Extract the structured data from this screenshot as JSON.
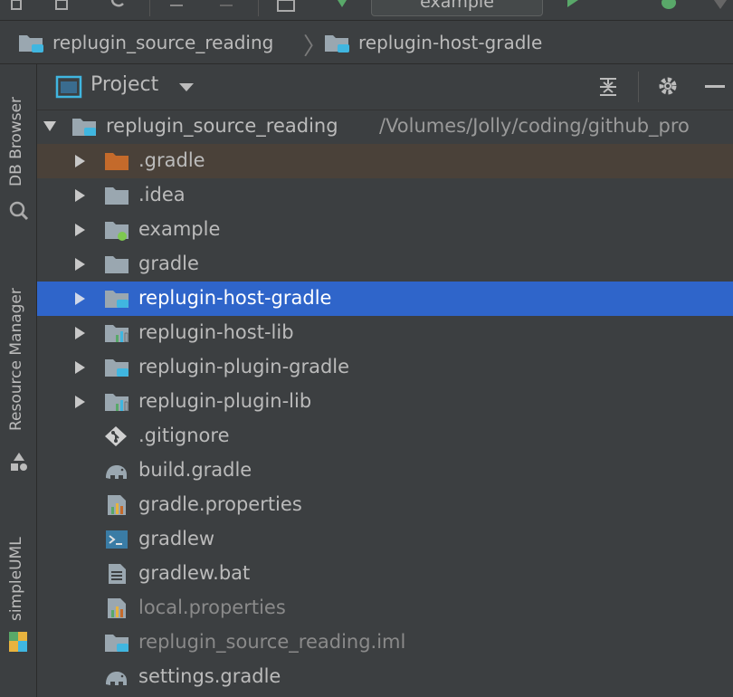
{
  "toolbar": {
    "run_config": "example"
  },
  "breadcrumb": {
    "items": [
      "replugin_source_reading",
      "replugin-host-gradle"
    ]
  },
  "side_tabs": {
    "db_browser": "DB Browser",
    "resource_manager": "Resource Manager",
    "simple_uml": "simpleUML"
  },
  "panel": {
    "title": "Project"
  },
  "tree": {
    "root": {
      "label": "replugin_source_reading",
      "path": "/Volumes/Jolly/coding/github_pro"
    },
    "items": [
      {
        "label": ".gradle",
        "icon": "folder-orange-icon"
      },
      {
        "label": ".idea",
        "icon": "folder-icon"
      },
      {
        "label": "example",
        "icon": "module-folder-icon"
      },
      {
        "label": "gradle",
        "icon": "folder-icon"
      },
      {
        "label": "replugin-host-gradle",
        "icon": "module-folder-icon"
      },
      {
        "label": "replugin-host-lib",
        "icon": "library-module-icon"
      },
      {
        "label": "replugin-plugin-gradle",
        "icon": "module-folder-icon"
      },
      {
        "label": "replugin-plugin-lib",
        "icon": "library-module-icon"
      },
      {
        "label": ".gitignore",
        "icon": "git-icon"
      },
      {
        "label": "build.gradle",
        "icon": "gradle-elephant-icon"
      },
      {
        "label": "gradle.properties",
        "icon": "properties-file-icon"
      },
      {
        "label": "gradlew",
        "icon": "shell-script-icon"
      },
      {
        "label": "gradlew.bat",
        "icon": "text-file-icon"
      },
      {
        "label": "local.properties",
        "icon": "properties-file-icon"
      },
      {
        "label": "replugin_source_reading.iml",
        "icon": "module-folder-icon"
      },
      {
        "label": "settings.gradle",
        "icon": "gradle-elephant-icon"
      }
    ]
  },
  "colors": {
    "background": "#3c3f41",
    "selection": "#2f65ca",
    "excluded_folder_tint": "#4a4139",
    "folder": "#9aa7b0",
    "module_accent": "#40b6e0"
  }
}
